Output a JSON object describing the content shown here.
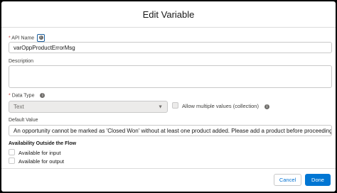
{
  "modal": {
    "title": "Edit Variable"
  },
  "api_name": {
    "required_marker": "*",
    "label": "API Name",
    "info_icon": "info-icon",
    "value": "varOppProductErrorMsg"
  },
  "description": {
    "label": "Description",
    "value": ""
  },
  "data_type": {
    "required_marker": "*",
    "label": "Data Type",
    "info_icon": "info-icon",
    "value": "Text",
    "dropdown_icon": "chevron-down-icon"
  },
  "collection": {
    "label": "Allow multiple values (collection)",
    "checked": false,
    "info_icon": "info-icon"
  },
  "default_value": {
    "label": "Default Value",
    "value": "An opportunity cannot be marked as 'Closed Won' without at least one product added. Please add a product before proceeding."
  },
  "availability": {
    "heading": "Availability Outside the Flow",
    "input_label": "Available for input",
    "output_label": "Available for output"
  },
  "footer": {
    "cancel_label": "Cancel",
    "done_label": "Done"
  },
  "colors": {
    "brand": "#0176d3",
    "required": "#c23934",
    "border": "#c9c9c9"
  }
}
